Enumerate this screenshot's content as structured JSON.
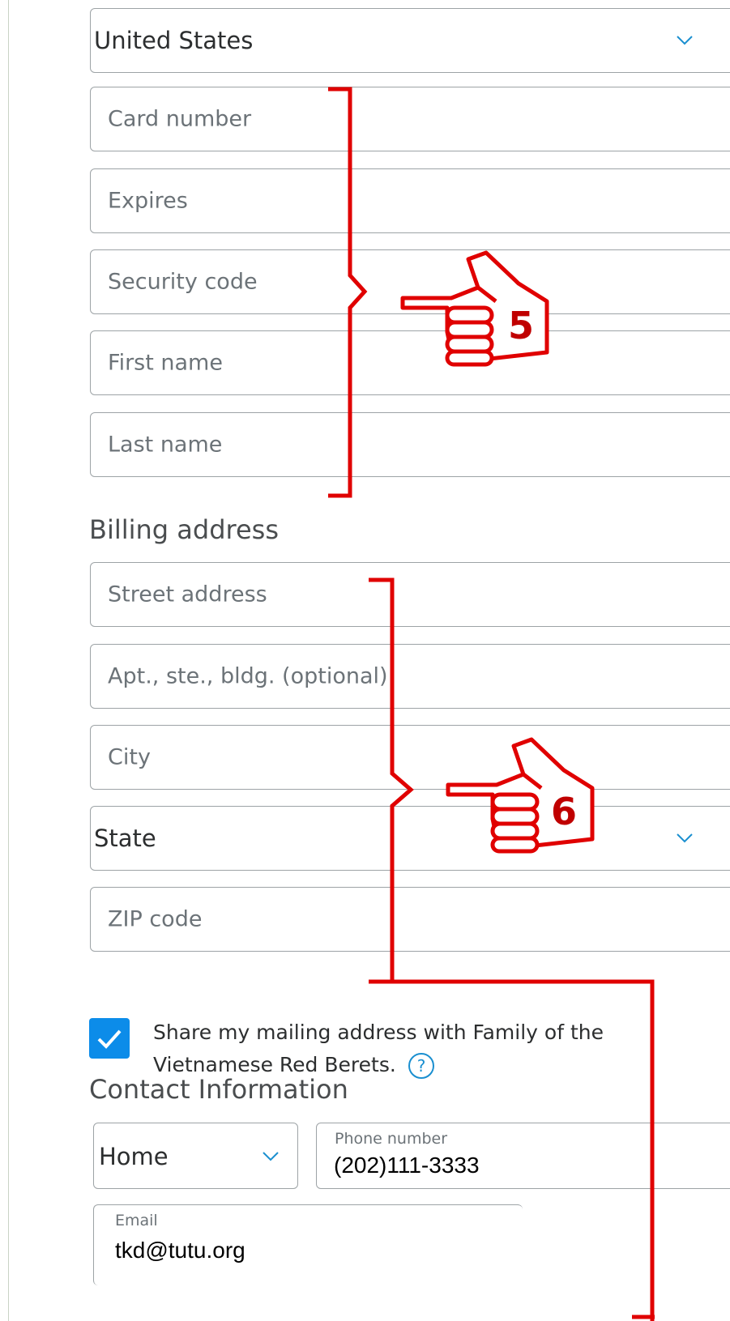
{
  "country_select": {
    "value": "United States"
  },
  "card_fields": {
    "card_number": "Card number",
    "expires": "Expires",
    "security_code": "Security code",
    "first_name": "First name",
    "last_name": "Last name"
  },
  "billing": {
    "heading": "Billing address",
    "street": "Street address",
    "apt": "Apt., ste., bldg. (optional)",
    "city": "City",
    "state": "State",
    "zip": "ZIP code"
  },
  "share": {
    "checked": true,
    "text": "Share my mailing address with Family of the Vietnamese Red Berets."
  },
  "contact": {
    "heading": "Contact Information",
    "phone_type": "Home",
    "phone_label": "Phone number",
    "phone_value": "(202)111-3333",
    "email_label": "Email",
    "email_value": "tkd@tutu.org"
  },
  "annotations": {
    "step5": "5",
    "step6": "6"
  },
  "colors": {
    "accent": "#0c8ce9",
    "annotation": "#e00000",
    "border": "#9da3a6"
  },
  "icons": [
    "chevron-down-icon",
    "check-icon",
    "help-icon",
    "pointing-hand-icon"
  ]
}
